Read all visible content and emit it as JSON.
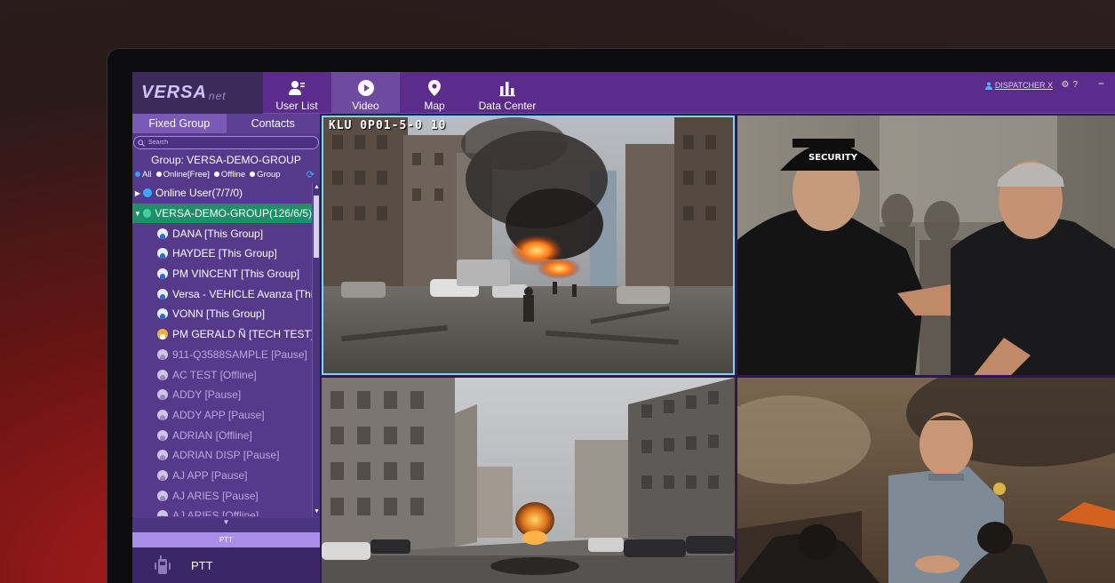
{
  "app": {
    "logo_text": "VERSA",
    "logo_sub": "net"
  },
  "nav": {
    "tabs": [
      {
        "label": "User List",
        "icon": "user-list-icon"
      },
      {
        "label": "Video",
        "icon": "play-icon",
        "active": true
      },
      {
        "label": "Map",
        "icon": "map-pin-icon"
      },
      {
        "label": "Data Center",
        "icon": "bar-chart-icon"
      }
    ]
  },
  "header": {
    "user": "DISPATCHER X",
    "settings_icon": "gear-icon",
    "help_icon": "help-icon",
    "minimize": "−"
  },
  "sidebar": {
    "tabs": [
      "Fixed Group",
      "Contacts"
    ],
    "active_tab": "Fixed Group",
    "search_placeholder": "Search",
    "group_label": "Group:  VERSA-DEMO-GROUP",
    "filters": [
      "All",
      "Online[Free]",
      "Offline",
      "Group"
    ],
    "tree": {
      "online_user": "Online User(7/7/0)",
      "group": "VERSA-DEMO-GROUP(126/6/5)",
      "members": [
        {
          "name": "DANA [This Group]",
          "status": "online"
        },
        {
          "name": "HAYDEE [This Group]",
          "status": "online"
        },
        {
          "name": "PM VINCENT [This Group]",
          "status": "online"
        },
        {
          "name": "Versa - VEHICLE Avanza [This Group]",
          "status": "online"
        },
        {
          "name": "VONN [This Group]",
          "status": "online"
        },
        {
          "name": "PM GERALD Ñ [TECH TEST]",
          "status": "online"
        },
        {
          "name": "911-Q3588SAMPLE [Pause]",
          "status": "offline"
        },
        {
          "name": "AC TEST [Offline]",
          "status": "offline"
        },
        {
          "name": "ADDY [Pause]",
          "status": "offline"
        },
        {
          "name": "ADDY APP [Pause]",
          "status": "offline"
        },
        {
          "name": "ADRIAN [Offline]",
          "status": "offline"
        },
        {
          "name": "ADRIAN DISP [Pause]",
          "status": "offline"
        },
        {
          "name": "AJ APP [Pause]",
          "status": "offline"
        },
        {
          "name": "AJ ARIES [Pause]",
          "status": "offline"
        },
        {
          "name": "AJ ARIES [Offline]",
          "status": "offline"
        }
      ]
    },
    "ptt_bar": "PTT",
    "ptt_label": "PTT"
  },
  "video": {
    "tile1_osd": "KLU 0P01-5-0 10"
  },
  "colors": {
    "topbar": "#5b2c8c",
    "sidebar": "#553a8c",
    "selected_row": "#1f8f6a",
    "accent": "#7fd3ff"
  }
}
